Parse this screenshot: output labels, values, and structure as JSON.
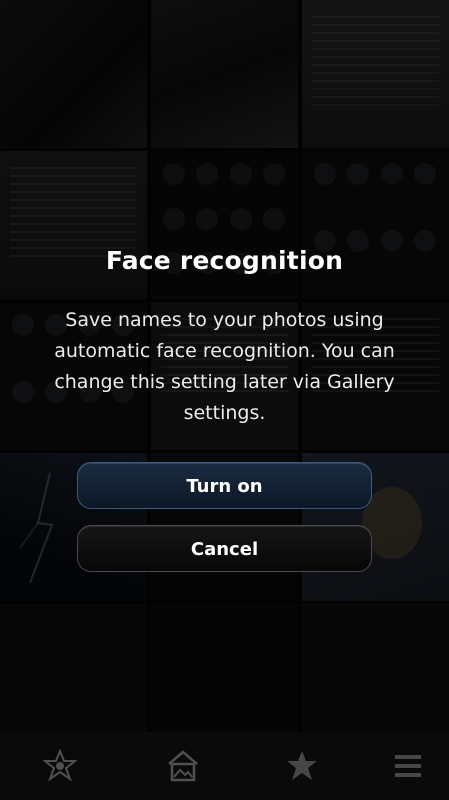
{
  "dialog": {
    "title": "Face recognition",
    "message": "Save names to your photos using automatic face recognition. You can change this setting later via Gallery settings.",
    "primary_button": "Turn on",
    "secondary_button": "Cancel"
  },
  "toolbar": {
    "items": [
      {
        "icon": "favorite-face-icon"
      },
      {
        "icon": "gallery-home-icon"
      },
      {
        "icon": "star-icon"
      },
      {
        "icon": "menu-icon"
      }
    ]
  },
  "colors": {
    "primary_button_border": "#3b5a80",
    "primary_button_fill": "#132338",
    "secondary_button_border": "#4a4a4a",
    "text": "#ffffff"
  }
}
